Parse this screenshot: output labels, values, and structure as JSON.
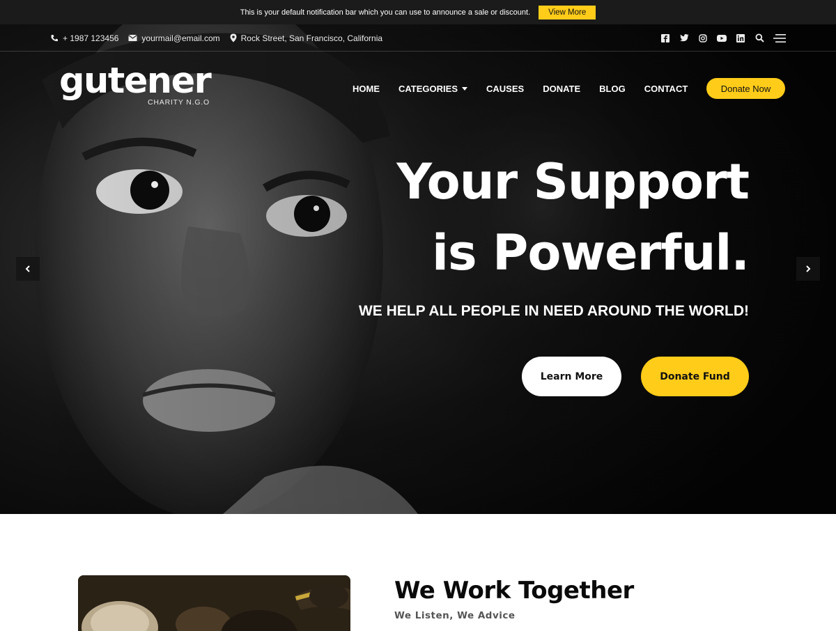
{
  "notification": {
    "text": "This is your default notification bar which you can use to announce a sale or discount.",
    "button_label": "View More"
  },
  "topbar": {
    "phone": "+ 1987 123456",
    "email": "yourmail@email.com",
    "address": "Rock Street, San Francisco, California",
    "social_icons": [
      "facebook-icon",
      "twitter-icon",
      "instagram-icon",
      "youtube-icon",
      "linkedin-icon"
    ]
  },
  "header": {
    "logo_text": "gutener",
    "logo_tagline": "CHARITY N.G.O",
    "nav": [
      {
        "label": "HOME"
      },
      {
        "label": "CATEGORIES",
        "has_dropdown": true
      },
      {
        "label": "CAUSES"
      },
      {
        "label": "DONATE"
      },
      {
        "label": "BLOG"
      },
      {
        "label": "CONTACT"
      }
    ],
    "cta_label": "Donate Now"
  },
  "hero": {
    "title_line1": "Your Support",
    "title_line2": "is Powerful.",
    "subtitle": "WE HELP ALL PEOPLE IN NEED AROUND THE WORLD!",
    "primary_button": "Learn More",
    "secondary_button": "Donate Fund"
  },
  "section": {
    "title": "We Work Together",
    "subtitle": "We Listen, We Advice"
  },
  "colors": {
    "accent": "#ffcc1a",
    "dark": "#1b1b1b"
  }
}
